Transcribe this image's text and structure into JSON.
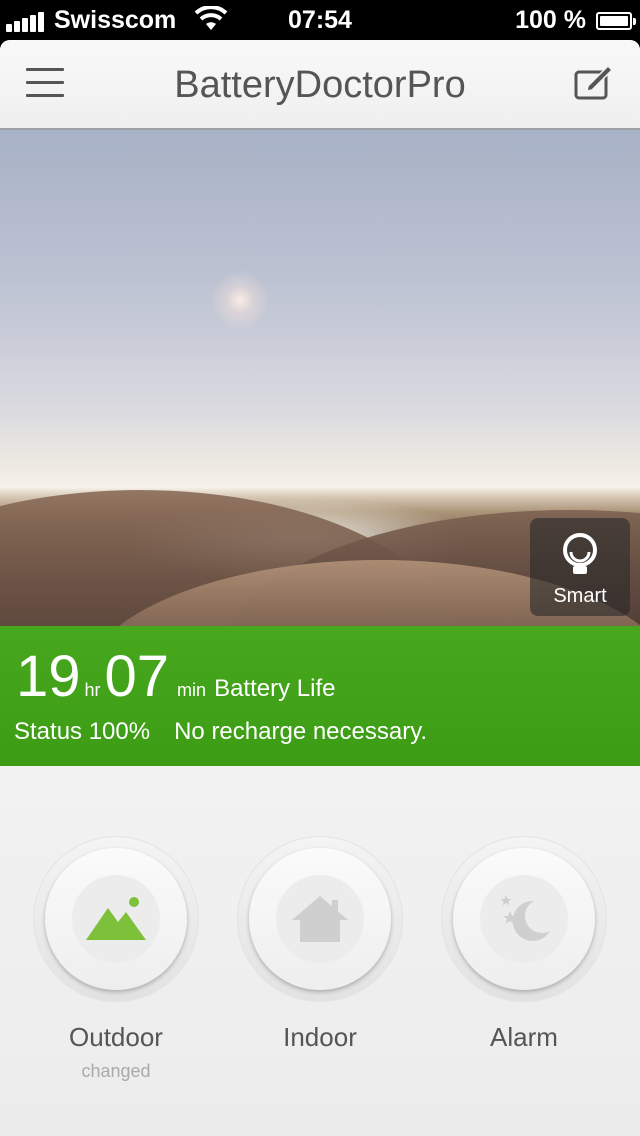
{
  "status_bar": {
    "carrier": "Swisscom",
    "time": "07:54",
    "battery_text": "100 %"
  },
  "navbar": {
    "title": "BatteryDoctorPro",
    "menu_icon": "hamburger-menu-icon",
    "edit_icon": "edit-icon"
  },
  "hero": {
    "smart_label": "Smart",
    "smart_icon": "lightbulb-icon"
  },
  "battery": {
    "hours": "19",
    "hours_unit": "hr",
    "minutes": "07",
    "minutes_unit": "min",
    "label": "Battery Life",
    "status": "Status 100%",
    "message": "No recharge necessary."
  },
  "modes": [
    {
      "label": "Outdoor",
      "sub": "changed",
      "icon": "mountain-icon",
      "active": true
    },
    {
      "label": "Indoor",
      "sub": "",
      "icon": "house-icon",
      "active": false
    },
    {
      "label": "Alarm",
      "sub": "",
      "icon": "moon-stars-icon",
      "active": false
    }
  ],
  "colors": {
    "accent_green": "#42a31a",
    "active_icon_green": "#7dc13b",
    "inactive_icon_gray": "#cfcfcf"
  }
}
